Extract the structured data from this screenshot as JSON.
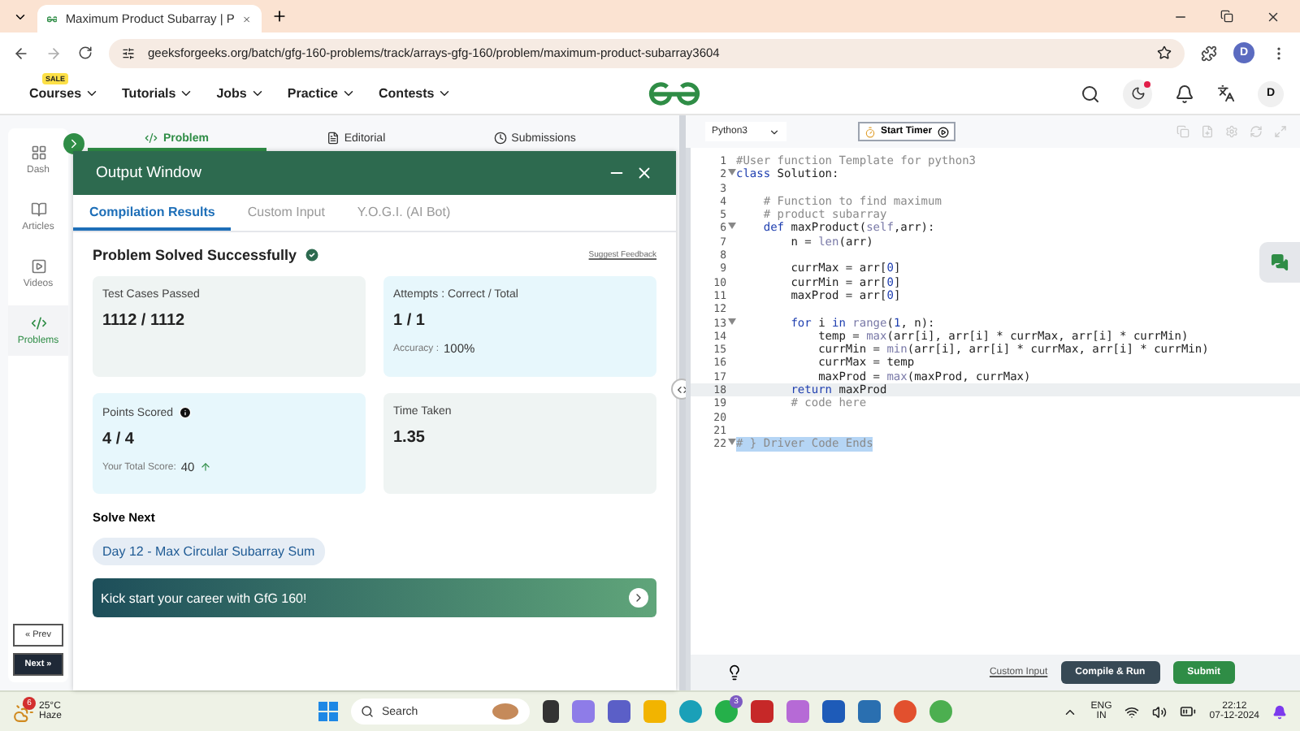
{
  "browser": {
    "tab_title": "Maximum Product Subarray | P",
    "url": "geeksforgeeks.org/batch/gfg-160-problems/track/arrays-gfg-160/problem/maximum-product-subarray3604",
    "profile": "D"
  },
  "site_nav": {
    "sale_badge": "SALE",
    "items": [
      "Courses",
      "Tutorials",
      "Jobs",
      "Practice",
      "Contests"
    ],
    "avatar": "D"
  },
  "sidebar": {
    "items": [
      {
        "label": "Dash",
        "kind": "dash",
        "selected": false
      },
      {
        "label": "Articles",
        "kind": "articles",
        "selected": false
      },
      {
        "label": "Videos",
        "kind": "videos",
        "selected": false
      },
      {
        "label": "Problems",
        "kind": "problems",
        "selected": true
      }
    ],
    "prev": "« Prev",
    "next": "Next »"
  },
  "problem_tabs": [
    {
      "label": "Problem",
      "kind": "code",
      "selected": true
    },
    {
      "label": "Editorial",
      "kind": "doc",
      "selected": false
    },
    {
      "label": "Submissions",
      "kind": "clock",
      "selected": false
    }
  ],
  "output_window": {
    "title": "Output Window",
    "tabs": [
      {
        "label": "Compilation Results",
        "selected": true
      },
      {
        "label": "Custom Input",
        "selected": false
      },
      {
        "label": "Y.O.G.I. (AI Bot)",
        "selected": false
      }
    ],
    "status": "Problem Solved Successfully",
    "feedback_link": "Suggest Feedback",
    "cards": [
      {
        "label": "Test Cases Passed",
        "value": "1112 / 1112",
        "color": "#eff4f3"
      },
      {
        "label": "Attempts : Correct / Total",
        "value": "1 / 1",
        "note_label": "Accuracy :",
        "note_value": "100%",
        "info": false,
        "trend_up": false,
        "color": "#e7f7fc"
      },
      {
        "label": "Points Scored",
        "info": true,
        "value": "4 / 4",
        "note_label": "Your Total Score:",
        "note_value": "40",
        "trend_up": true,
        "color": "#e7f7fc"
      },
      {
        "label": "Time Taken",
        "value": "1.35",
        "color": "#eff4f3"
      }
    ],
    "solve_next_heading": "Solve Next",
    "next_problem": "Day 12 - Max Circular Subarray Sum",
    "banner": "Kick start your career with GfG 160!"
  },
  "editor": {
    "language": "Python3",
    "timer_button": "Start Timer",
    "lines": [
      {
        "n": "1",
        "fold": false,
        "active": false,
        "selected": false,
        "tokens": [
          {
            "text": "#User function Template for python3",
            "kind": "comment"
          }
        ]
      },
      {
        "n": "2",
        "fold": true,
        "active": false,
        "selected": false,
        "tokens": [
          {
            "text": "class",
            "kind": "keyword"
          },
          {
            "text": " Solution:",
            "kind": "plain"
          }
        ]
      },
      {
        "n": "3",
        "fold": false,
        "active": false,
        "selected": false
      },
      {
        "n": "4",
        "fold": false,
        "active": false,
        "selected": false,
        "tokens": [
          {
            "text": "    # Function to find maximum",
            "kind": "comment"
          }
        ]
      },
      {
        "n": "5",
        "fold": false,
        "active": false,
        "selected": false,
        "tokens": [
          {
            "text": "    # product subarray",
            "kind": "comment"
          }
        ]
      },
      {
        "n": "6",
        "fold": true,
        "active": false,
        "selected": false,
        "tokens": [
          {
            "text": "    def",
            "kind": "keyword"
          },
          {
            "text": " maxProduct(",
            "kind": "plain"
          },
          {
            "text": "self",
            "kind": "builtin"
          },
          {
            "text": ",arr):",
            "kind": "plain"
          }
        ]
      },
      {
        "n": "7",
        "fold": false,
        "active": false,
        "selected": false,
        "tokens": [
          {
            "text": "        n = ",
            "kind": "plain"
          },
          {
            "text": "len",
            "kind": "builtin"
          },
          {
            "text": "(arr)",
            "kind": "plain"
          }
        ]
      },
      {
        "n": "8",
        "fold": false,
        "active": false,
        "selected": false
      },
      {
        "n": "9",
        "fold": false,
        "active": false,
        "selected": false,
        "tokens": [
          {
            "text": "        currMax = arr[",
            "kind": "plain"
          },
          {
            "text": "0",
            "kind": "number"
          },
          {
            "text": "]",
            "kind": "plain"
          }
        ]
      },
      {
        "n": "10",
        "fold": false,
        "active": false,
        "selected": false,
        "tokens": [
          {
            "text": "        currMin = arr[",
            "kind": "plain"
          },
          {
            "text": "0",
            "kind": "number"
          },
          {
            "text": "]",
            "kind": "plain"
          }
        ]
      },
      {
        "n": "11",
        "fold": false,
        "active": false,
        "selected": false,
        "tokens": [
          {
            "text": "        maxProd = arr[",
            "kind": "plain"
          },
          {
            "text": "0",
            "kind": "number"
          },
          {
            "text": "]",
            "kind": "plain"
          }
        ]
      },
      {
        "n": "12",
        "fold": false,
        "active": false,
        "selected": false
      },
      {
        "n": "13",
        "fold": true,
        "active": false,
        "selected": false,
        "tokens": [
          {
            "text": "        for",
            "kind": "keyword"
          },
          {
            "text": " i ",
            "kind": "plain"
          },
          {
            "text": "in",
            "kind": "keyword"
          },
          {
            "text": " range",
            "kind": "builtin"
          },
          {
            "text": "(",
            "kind": "plain"
          },
          {
            "text": "1",
            "kind": "number"
          },
          {
            "text": ", n):",
            "kind": "plain"
          }
        ]
      },
      {
        "n": "14",
        "fold": false,
        "active": false,
        "selected": false,
        "tokens": [
          {
            "text": "            temp = ",
            "kind": "plain"
          },
          {
            "text": "max",
            "kind": "builtin"
          },
          {
            "text": "(arr[i], arr[i] * currMax, arr[i] * currMin)",
            "kind": "plain"
          }
        ]
      },
      {
        "n": "15",
        "fold": false,
        "active": false,
        "selected": false,
        "tokens": [
          {
            "text": "            currMin = ",
            "kind": "plain"
          },
          {
            "text": "min",
            "kind": "builtin"
          },
          {
            "text": "(arr[i], arr[i] * currMax, arr[i] * currMin)",
            "kind": "plain"
          }
        ]
      },
      {
        "n": "16",
        "fold": false,
        "active": false,
        "selected": false,
        "tokens": [
          {
            "text": "            currMax = temp",
            "kind": "plain"
          }
        ]
      },
      {
        "n": "17",
        "fold": false,
        "active": false,
        "selected": false,
        "tokens": [
          {
            "text": "            maxProd = ",
            "kind": "plain"
          },
          {
            "text": "max",
            "kind": "builtin"
          },
          {
            "text": "(maxProd, currMax)",
            "kind": "plain"
          }
        ]
      },
      {
        "n": "18",
        "fold": false,
        "active": true,
        "selected": false,
        "tokens": [
          {
            "text": "        return",
            "kind": "keyword"
          },
          {
            "text": " maxProd",
            "kind": "plain"
          }
        ]
      },
      {
        "n": "19",
        "fold": false,
        "active": false,
        "selected": false,
        "tokens": [
          {
            "text": "        # code here",
            "kind": "comment"
          }
        ]
      },
      {
        "n": "20",
        "fold": false,
        "active": false,
        "selected": false
      },
      {
        "n": "21",
        "fold": false,
        "active": false,
        "selected": false
      },
      {
        "n": "22",
        "fold": true,
        "active": false,
        "selected": true,
        "tokens": [
          {
            "text": "# } Driver Code Ends",
            "kind": "comment"
          }
        ]
      }
    ],
    "custom_input_link": "Custom Input",
    "compile_button": "Compile & Run",
    "submit_button": "Submit"
  },
  "taskbar": {
    "temperature": "25°C",
    "weather": "Haze",
    "weather_badge": "6",
    "search_placeholder": "Search",
    "chat_badge": "3",
    "language": "ENG",
    "region": "IN",
    "time": "22:12",
    "date": "07-12-2024"
  }
}
